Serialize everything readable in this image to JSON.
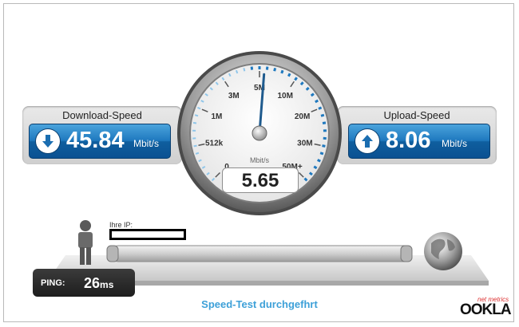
{
  "download": {
    "title": "Download-Speed",
    "value": "45.84",
    "unit": "Mbit/s"
  },
  "upload": {
    "title": "Upload-Speed",
    "value": "8.06",
    "unit": "Mbit/s"
  },
  "gauge": {
    "unit_label": "Mbit/s",
    "current_value": "5.65",
    "current_mbit": 5.65,
    "ticks": [
      {
        "label": "0"
      },
      {
        "label": "512k"
      },
      {
        "label": "1M"
      },
      {
        "label": "3M"
      },
      {
        "label": "5M"
      },
      {
        "label": "10M"
      },
      {
        "label": "20M"
      },
      {
        "label": "30M"
      },
      {
        "label": "50M+"
      }
    ]
  },
  "ip": {
    "label": "Ihre IP:"
  },
  "ping": {
    "label": "PING:",
    "value": "26",
    "unit": "ms"
  },
  "status": {
    "text": "Speed-Test durchgefhrt"
  },
  "branding": {
    "logo": "OOKLA",
    "tagline": "net metrics"
  },
  "colors": {
    "accent_blue": "#1f79bf",
    "status_text": "#3da0d8",
    "gauge_needle": "#1f5b8e"
  }
}
